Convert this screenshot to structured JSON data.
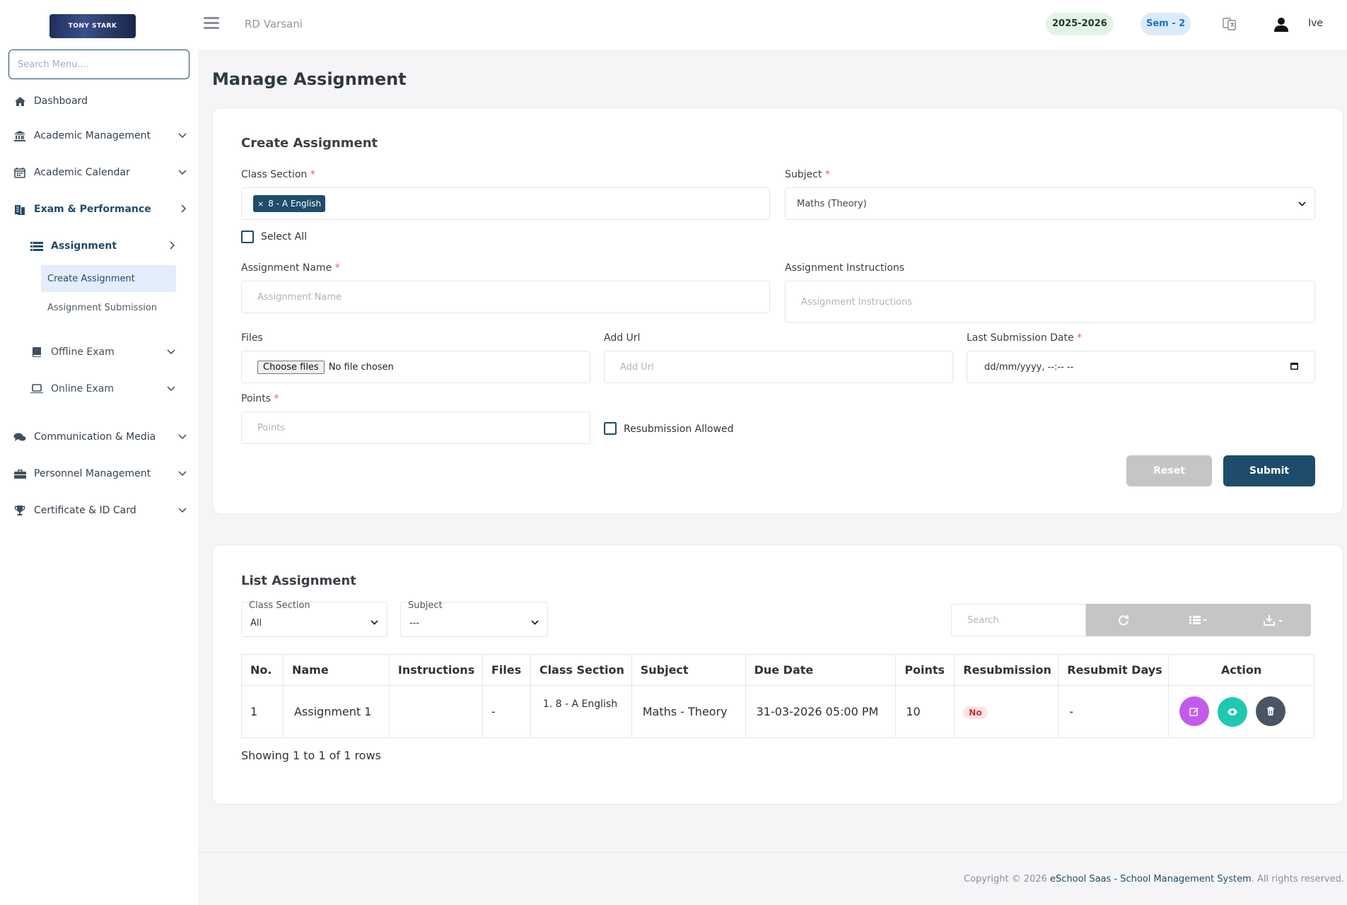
{
  "sidebar": {
    "logo_text": "TONY STARK",
    "search_placeholder": "Search Menu....",
    "items": [
      {
        "label": "Dashboard"
      },
      {
        "label": "Academic Management"
      },
      {
        "label": "Academic Calendar"
      },
      {
        "label": "Exam & Performance"
      },
      {
        "label": "Communication & Media"
      },
      {
        "label": "Personnel Management"
      },
      {
        "label": "Certificate & ID Card"
      }
    ],
    "sub_items": [
      {
        "label": "Assignment"
      },
      {
        "label": "Offline Exam"
      },
      {
        "label": "Online Exam"
      }
    ],
    "leaves": [
      {
        "label": "Create Assignment"
      },
      {
        "label": "Assignment Submission"
      }
    ]
  },
  "topbar": {
    "school": "RD Varsani",
    "year": "2025-2026",
    "sem": "Sem - 2",
    "user": "Ive"
  },
  "page": {
    "title": "Manage Assignment"
  },
  "create": {
    "title": "Create Assignment",
    "class_section_label": "Class Section",
    "class_section_chip": "8 - A English",
    "subject_label": "Subject",
    "subject_value": "Maths (Theory)",
    "select_all": "Select All",
    "name_label": "Assignment Name",
    "name_placeholder": "Assignment Name",
    "instructions_label": "Assignment Instructions",
    "instructions_placeholder": "Assignment Instructions",
    "files_label": "Files",
    "choose_files": "Choose files",
    "no_file": "No file chosen",
    "url_label": "Add Url",
    "url_placeholder": "Add Url",
    "date_label": "Last Submission Date",
    "date_placeholder": "dd/mm/yyyy, --:-- --",
    "points_label": "Points",
    "points_placeholder": "Points",
    "resubmission": "Resubmission Allowed",
    "reset": "Reset",
    "submit": "Submit",
    "required_mark": "*"
  },
  "list": {
    "title": "List Assignment",
    "filter_class_label": "Class Section",
    "filter_class_value": "All",
    "filter_subject_label": "Subject",
    "filter_subject_value": "---",
    "search_placeholder": "Search",
    "columns": [
      "No.",
      "Name",
      "Instructions",
      "Files",
      "Class Section",
      "Subject",
      "Due Date",
      "Points",
      "Resubmission",
      "Resubmit Days",
      "Action"
    ],
    "rows": [
      {
        "no": "1",
        "name": "Assignment 1",
        "instructions": "",
        "files": "-",
        "class_section": "1. 8 - A English",
        "subject": "Maths - Theory",
        "due": "31-03-2026 05:00 PM",
        "points": "10",
        "resubmission": "No",
        "resubmit_days": "-"
      }
    ],
    "showing": "Showing 1 to 1 of 1 rows"
  },
  "footer": {
    "prefix": "Copyright © 2026 ",
    "link": "eSchool Saas - School Management System",
    "suffix": ". All rights reserved."
  },
  "colors": {
    "primary": "#1e4d6b",
    "reset": "#c7c4c4",
    "edit": "#c25bec",
    "view": "#1ec9b0",
    "delete": "#4a5564"
  }
}
